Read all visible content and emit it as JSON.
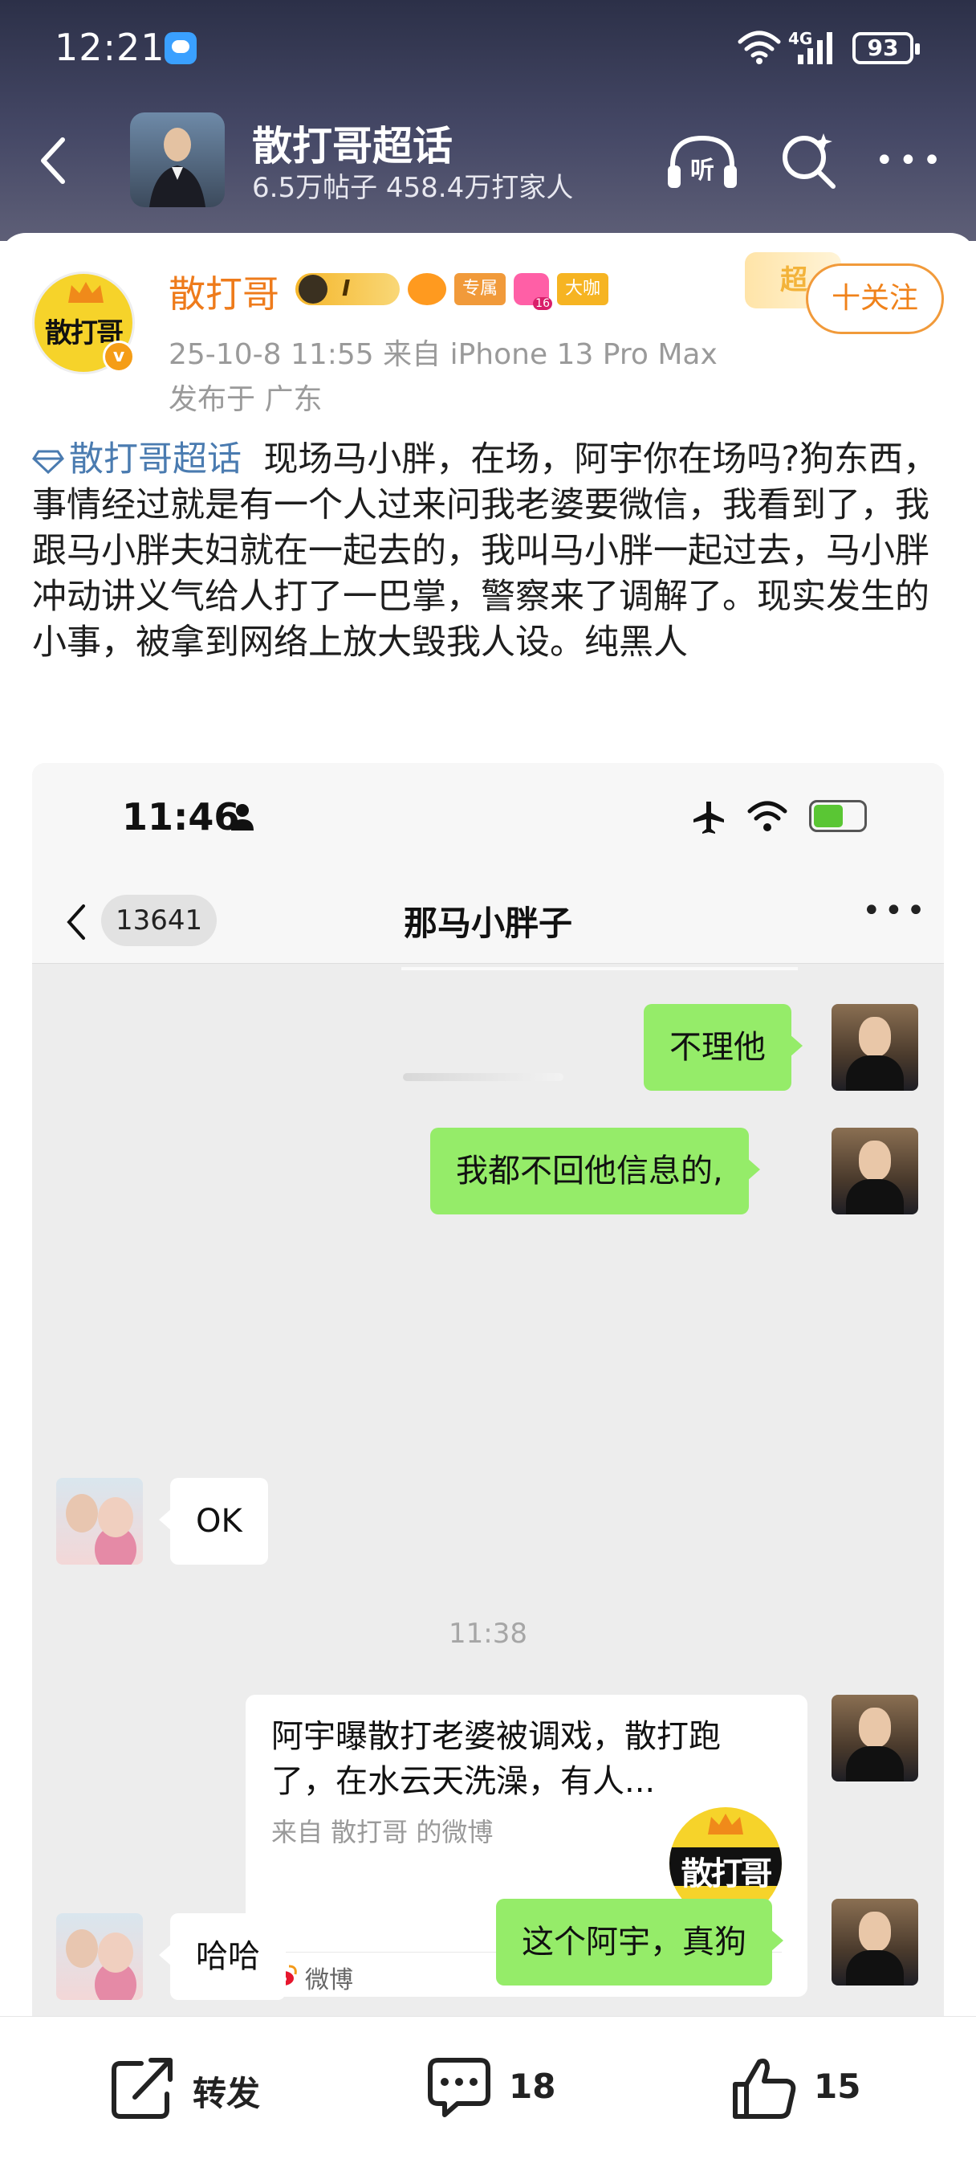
{
  "status_bar": {
    "time": "12:21",
    "network": "4G",
    "battery": "93"
  },
  "header": {
    "group_title": "散打哥超话",
    "group_meta": "6.5万帖子 458.4万打家人",
    "listen_icon_text": "听"
  },
  "post": {
    "author_name": "散打哥",
    "avatar_logo_text": "散打哥",
    "verified_mark": "v",
    "badge_level": "I",
    "badge_exclusive": "专属",
    "badge_gem_number": "16",
    "badge_bigshot": "大咖",
    "super_tag": "超",
    "follow_label": "十关注",
    "timestamp": "25-10-8 11:55  来自 iPhone 13 Pro Max",
    "location": "发布于 广东",
    "topic": "散打哥超话",
    "body": "现场马小胖，在场，阿宇你在场吗?狗东西，事情经过就是有一个人过来问我老婆要微信，我看到了，我跟马小胖夫妇就在一起去的，我叫马小胖一起过去，马小胖冲动讲义气给人打了一巴掌，警察来了调解了。现实发生的小事，被拿到网络上放大毁我人设。纯黑人"
  },
  "chat_screenshot": {
    "time": "11:46",
    "unread_count": "13641",
    "title": "那马小胖子",
    "messages": [
      {
        "side": "me",
        "text": "不理他"
      },
      {
        "side": "me",
        "text": "我都不回他信息的,"
      },
      {
        "side": "them",
        "text": "OK"
      },
      {
        "side": "me",
        "text": "这个阿宇，真狗"
      },
      {
        "side": "them",
        "text": "哈哈"
      }
    ],
    "time_separator": "11:38",
    "share_card": {
      "title": "阿宇曝散打老婆被调戏，散打跑了，在水云天洗澡，有人...",
      "source": "来自 散打哥 的微博",
      "logo_text": "散打哥",
      "platform": "微博"
    }
  },
  "actions": {
    "repost_label": "转发",
    "comment_count": "18",
    "like_count": "15"
  }
}
